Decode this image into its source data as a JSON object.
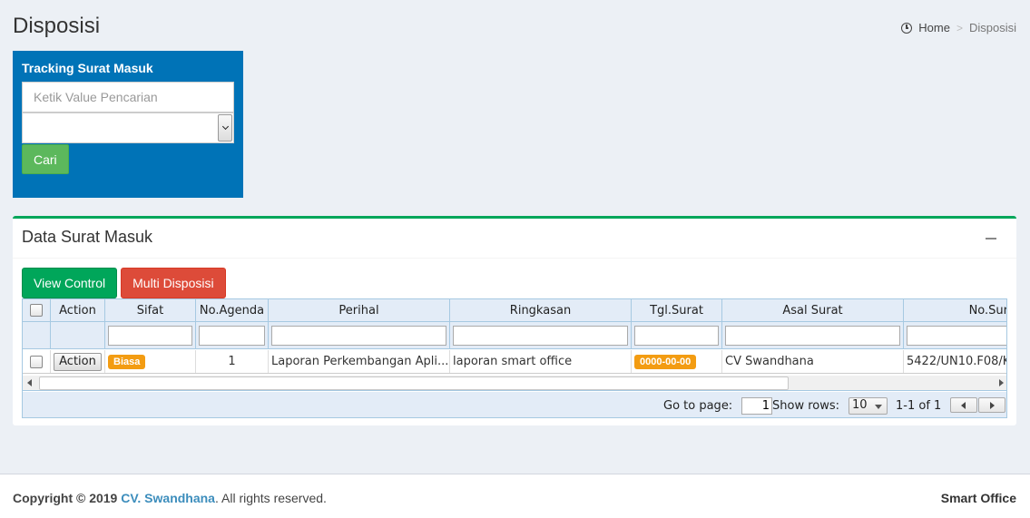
{
  "page": {
    "title": "Disposisi"
  },
  "breadcrumb": {
    "home": "Home",
    "separator": ">",
    "current": "Disposisi"
  },
  "tracking": {
    "title": "Tracking Surat Masuk",
    "search_placeholder": "Ketik Value Pencarian",
    "search_value": "",
    "select_value": "",
    "button": "Cari"
  },
  "data_box": {
    "title": "Data Surat Masuk",
    "buttons": {
      "view_control": "View Control",
      "multi_disposisi": "Multi Disposisi"
    }
  },
  "grid": {
    "columns": [
      "Action",
      "Sifat",
      "No.Agenda",
      "Perihal",
      "Ringkasan",
      "Tgl.Surat",
      "Asal Surat",
      "No.Sur"
    ],
    "rows": [
      {
        "action": "Action",
        "sifat": "Biasa",
        "no_agenda": "1",
        "perihal": "Laporan Perkembangan Apli...",
        "ringkasan": "laporan smart office",
        "tgl_surat": "0000-00-00",
        "asal_surat": "CV Swandhana",
        "no_surat": "5422/UN10.F08/K"
      }
    ],
    "pager": {
      "goto_label": "Go to page:",
      "page": "1",
      "show_rows_label": "Show rows:",
      "rows": "10",
      "range": "1-1 of 1"
    }
  },
  "footer": {
    "copyright_prefix": "Copyright © 2019",
    "company": "CV. Swandhana",
    "suffix": ". All rights reserved.",
    "brand": "Smart Office"
  },
  "colors": {
    "tracking_bg": "#0073b7",
    "box_border": "#00a65a",
    "badge": "#f39c12",
    "danger": "#dd4b39",
    "link": "#3c8dbc"
  },
  "icons": {
    "home": "clock-icon",
    "collapse": "minus-icon"
  }
}
